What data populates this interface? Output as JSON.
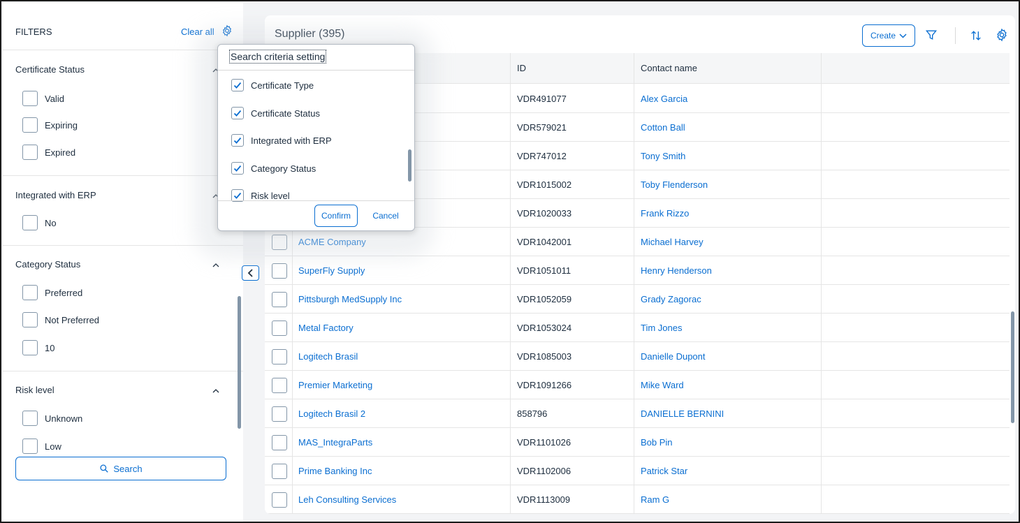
{
  "filters": {
    "title": "FILTERS",
    "clear_all": "Clear all",
    "groups": [
      {
        "title": "Certificate Status",
        "options": [
          "Valid",
          "Expiring",
          "Expired"
        ]
      },
      {
        "title": "Integrated with ERP",
        "options": [
          "No"
        ]
      },
      {
        "title": "Category Status",
        "options": [
          "Preferred",
          "Not Preferred",
          "10"
        ]
      },
      {
        "title": "Risk level",
        "options": [
          "Unknown",
          "Low"
        ]
      }
    ],
    "search_label": "Search"
  },
  "table": {
    "title": "Supplier (395)",
    "create_label": "Create",
    "columns": [
      "",
      "ID",
      "Contact name"
    ],
    "rows": [
      {
        "name": "",
        "id": "VDR491077",
        "contact": "Alex Garcia"
      },
      {
        "name": "",
        "id": "VDR579021",
        "contact": "Cotton Ball"
      },
      {
        "name": "",
        "id": "VDR747012",
        "contact": "Tony Smith"
      },
      {
        "name": "",
        "id": "VDR1015002",
        "contact": "Toby Flenderson"
      },
      {
        "name": "",
        "id": "VDR1020033",
        "contact": "Frank Rizzo"
      },
      {
        "name": "ACME Company",
        "id": "VDR1042001",
        "contact": "Michael Harvey"
      },
      {
        "name": "SuperFly Supply",
        "id": "VDR1051011",
        "contact": "Henry Henderson"
      },
      {
        "name": "Pittsburgh MedSupply Inc",
        "id": "VDR1052059",
        "contact": "Grady Zagorac"
      },
      {
        "name": "Metal Factory",
        "id": "VDR1053024",
        "contact": "Tim Jones"
      },
      {
        "name": "Logitech Brasil",
        "id": "VDR1085003",
        "contact": "Danielle Dupont"
      },
      {
        "name": "Premier Marketing",
        "id": "VDR1091266",
        "contact": "Mike Ward"
      },
      {
        "name": "Logitech Brasil 2",
        "id": "858796",
        "contact": "DANIELLE BERNINI"
      },
      {
        "name": "MAS_IntegraParts",
        "id": "VDR1101026",
        "contact": "Bob Pin"
      },
      {
        "name": "Prime Banking Inc",
        "id": "VDR1102006",
        "contact": "Patrick Star"
      },
      {
        "name": "Leh Consulting Services",
        "id": "VDR1113009",
        "contact": "Ram G"
      }
    ]
  },
  "popover": {
    "title": "Search criteria setting",
    "items": [
      {
        "label": "Certificate Type",
        "checked": true
      },
      {
        "label": "Certificate Status",
        "checked": true
      },
      {
        "label": "Integrated with ERP",
        "checked": true
      },
      {
        "label": "Category Status",
        "checked": true
      },
      {
        "label": "Risk level",
        "checked": true
      }
    ],
    "confirm_label": "Confirm",
    "cancel_label": "Cancel"
  },
  "icons": {
    "filters_settings": "gear-icon",
    "search": "search-icon",
    "collapse": "chevron-left-icon",
    "create_dropdown": "chevron-down-icon",
    "filter": "filter-icon",
    "sort": "sort-icon",
    "table_settings": "gear-icon",
    "group_toggle": "chevron-up-icon",
    "checkmark": "checkmark-icon"
  },
  "colors": {
    "accent": "#0a6ed1",
    "text": "#1d2d3e",
    "border": "#8396a8"
  }
}
